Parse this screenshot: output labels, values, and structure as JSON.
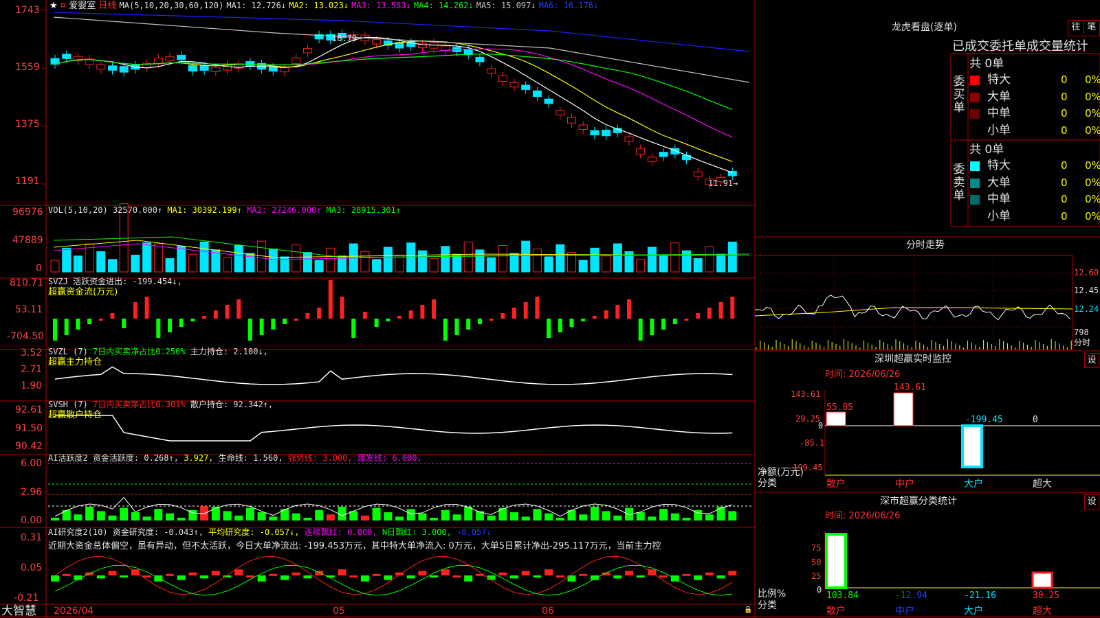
{
  "colors": {
    "up": "#ff2020",
    "down": "#00e5ff",
    "green": "#00ff00",
    "grid": "#b00000",
    "yellow": "#ffff00",
    "magenta": "#ff00ff",
    "white": "#ffffff",
    "blue": "#2020ff"
  },
  "main": {
    "stock_name": "爱婴室",
    "period": "日线",
    "ma_params": "MA(5,10,20,30,60,120)",
    "ma1": "MA1: 12.726↓",
    "ma2": "MA2: 13.023↓",
    "ma3": "MA3: 13.583↓",
    "ma4": "MA4: 14.262↓",
    "ma5": "MA5: 15.097↓",
    "ma6": "MA6: 16.176↓",
    "y_labels": [
      "1743",
      "1559",
      "1375",
      "1191"
    ],
    "high_label": "16.79",
    "low_label": "11.91→"
  },
  "vol": {
    "params": "VOL(5,10,20)",
    "value": "32570.000↑",
    "ma1": "MA1: 30392.199↑",
    "ma2": "MA2: 27246.000↑",
    "ma3": "MA3: 28915.301↑",
    "y_labels": [
      "96976",
      "47889",
      "0"
    ]
  },
  "svzj": {
    "title": "SVZJ",
    "label": "活跃资金进出: -199.454↓,",
    "sub": "超赢资金流(万元)",
    "y_labels": [
      "810.71",
      "53.11",
      "-704.50"
    ]
  },
  "svzl": {
    "title": "SVZL (7)",
    "label1": "7日内买卖净占比0.256%",
    "label2": "主力持仓: 2.100↓,",
    "sub": "超赢主力持仓",
    "y_labels": [
      "3.52",
      "2.71",
      "1.90"
    ]
  },
  "svsh": {
    "title": "SVSH (7)",
    "label1": "7日内买卖净占比0.301%",
    "label2": "散户持仓: 92.342↑,",
    "sub": "超赢散户持仓",
    "y_labels": [
      "92.61",
      "91.50",
      "90.42"
    ]
  },
  "ai1": {
    "title": "AI活跃度2",
    "l1": "资金活跃度: 0.268↑,",
    "l2": "3.927,",
    "l3": "生命线: 1.560,",
    "l4": "强势线: 3.000,",
    "l5": "爆发线: 6.000,",
    "y_labels": [
      "6.00",
      "2.96",
      "0.00"
    ]
  },
  "ai2": {
    "title": "AI研究度2(10)",
    "l1": "资金研究度: -0.043↑,",
    "l2": "平均研究度: -0.057↓,",
    "l3": "连续飘红: 0.000,",
    "l4": "N日飘红: 3.000,",
    "l5": "-0.057↓",
    "comment": "近期大资金总体偏空，虽有异动，但不太活跃，今日大单净流出: -199.453万元，其中特大单净流入: 0万元，大单5日累计净出-295.117万元，当前主力控",
    "y_labels": [
      "0.31",
      "0.05",
      "-0.21"
    ]
  },
  "bottom": {
    "brand": "大智慧",
    "date": "2026/04",
    "m5": "05",
    "m6": "06"
  },
  "right": {
    "top_title": "龙虎看盘(逐单)",
    "btn_wang": "往",
    "btn_bi": "笔",
    "table_header": "已成交委托单成交量统计",
    "buy_group": "委买单",
    "sell_group": "委卖单",
    "buy_total": "共 0单",
    "sell_total": "共 0单",
    "buy_rows": [
      {
        "name": "特大",
        "v": "0",
        "p": "0%"
      },
      {
        "name": "大单",
        "v": "0",
        "p": "0%"
      },
      {
        "name": "中单",
        "v": "0",
        "p": "0%"
      },
      {
        "name": "小单",
        "v": "0",
        "p": "0%"
      }
    ],
    "sell_rows": [
      {
        "name": "特大",
        "v": "0",
        "p": "0%"
      },
      {
        "name": "大单",
        "v": "0",
        "p": "0%"
      },
      {
        "name": "中单",
        "v": "0",
        "p": "0%"
      },
      {
        "name": "小单",
        "v": "0",
        "p": "0%"
      }
    ],
    "intraday_title": "分时走势",
    "intraday_y": [
      "12.60",
      "12.45",
      "12.24"
    ],
    "intraday_vol": "798",
    "intraday_vol_unit": "分时",
    "monitor_title": "深圳超赢实时监控",
    "monitor_set": "设",
    "monitor_time": "时间: 2026/06/26",
    "monitor_y": [
      "143.61",
      "29.25",
      "0",
      "-85.1",
      "-199.45"
    ],
    "monitor_vals": {
      "sanhu": "55.85",
      "zhonghu": "143.61",
      "dahu": "-199.45",
      "chaoda": "0"
    },
    "monitor_axis_label": "净额(万元)",
    "monitor_cat_label": "分类",
    "monitor_cats": [
      "散户",
      "中户",
      "大户",
      "超大"
    ],
    "stat_title": "深市超赢分类统计",
    "stat_set": "设",
    "stat_time": "时间: 2026/06/26",
    "stat_y": [
      "75",
      "50",
      "25",
      "0"
    ],
    "stat_axis_label": "比例%",
    "stat_cat_label": "分类",
    "stat_vals": [
      "103.84",
      "-12.94",
      "-21.16",
      "30.25"
    ],
    "stat_cats": [
      "散户",
      "中户",
      "大户",
      "超大"
    ]
  }
}
